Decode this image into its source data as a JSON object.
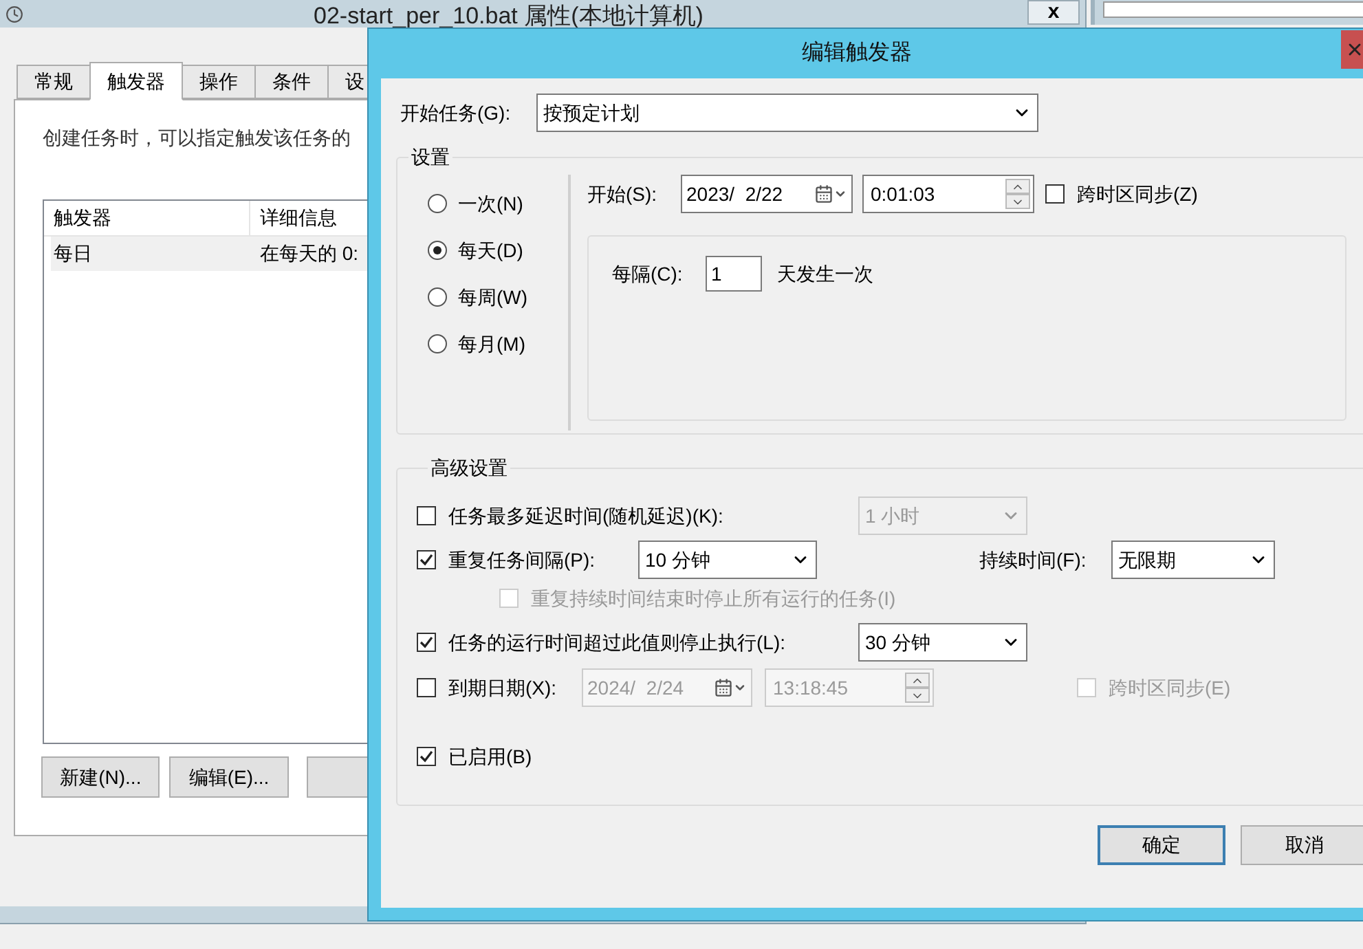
{
  "background_window": {
    "title": "02-start_per_10.bat 属性(本地计算机)",
    "close": "x",
    "tabs": [
      {
        "label": "常规",
        "selected": false
      },
      {
        "label": "触发器",
        "selected": true
      },
      {
        "label": "操作",
        "selected": false
      },
      {
        "label": "条件",
        "selected": false
      },
      {
        "label": "设",
        "selected": false
      }
    ],
    "description": "创建任务时，可以指定触发该任务的",
    "list": {
      "columns": [
        "触发器",
        "详细信息"
      ],
      "rows": [
        {
          "cells": [
            "每日",
            "在每天的 0:"
          ],
          "selected": true
        }
      ]
    },
    "buttons": [
      "新建(N)...",
      "编辑(E)..."
    ]
  },
  "dialog": {
    "title": "编辑触发器",
    "start_task": {
      "label": "开始任务(G):",
      "value": "按预定计划"
    },
    "settings": {
      "title": "设置",
      "schedules": [
        {
          "label": "一次(N)",
          "selected": false
        },
        {
          "label": "每天(D)",
          "selected": true
        },
        {
          "label": "每周(W)",
          "selected": false
        },
        {
          "label": "每月(M)",
          "selected": false
        }
      ],
      "start": {
        "label": "开始(S):",
        "date": "2023/  2/22",
        "time": "0:01:03",
        "sync": {
          "label": "跨时区同步(Z)",
          "checked": false
        }
      },
      "recur": {
        "label": "每隔(C):",
        "value": "1",
        "suffix": "天发生一次"
      }
    },
    "advanced": {
      "title": "高级设置",
      "delay": {
        "label": "任务最多延迟时间(随机延迟)(K):",
        "checked": false,
        "value": "1 小时"
      },
      "repeat": {
        "label": "重复任务间隔(P):",
        "checked": true,
        "value": "10 分钟",
        "duration_label": "持续时间(F):",
        "duration_value": "无限期"
      },
      "stop_all": {
        "label": "重复持续时间结束时停止所有运行的任务(I)",
        "checked": false,
        "disabled": true
      },
      "stop_after": {
        "label": "任务的运行时间超过此值则停止执行(L):",
        "checked": true,
        "value": "30 分钟"
      },
      "expire": {
        "label": "到期日期(X):",
        "checked": false,
        "date": "2024/  2/24",
        "time": "13:18:45",
        "sync": {
          "label": "跨时区同步(E)",
          "checked": false,
          "disabled": true
        }
      },
      "enabled": {
        "label": "已启用(B)",
        "checked": true
      }
    },
    "buttons": [
      {
        "label": "确定",
        "default": true
      },
      {
        "label": "取消",
        "default": false
      }
    ]
  }
}
